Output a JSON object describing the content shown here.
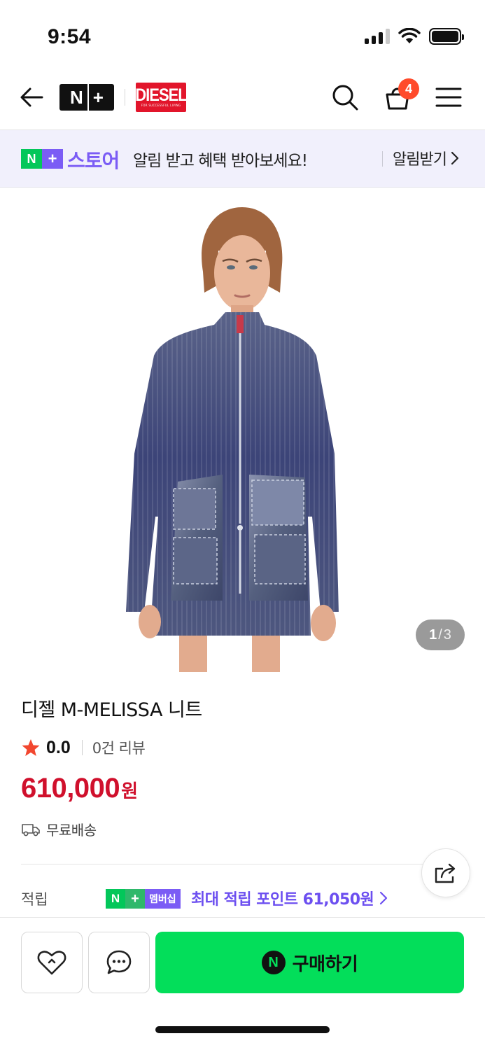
{
  "status_bar": {
    "time": "9:54",
    "icons": [
      "signal-icon",
      "wifi-icon",
      "battery-icon"
    ]
  },
  "nav": {
    "back_icon": "arrow-left-icon",
    "nplus_logo": "N+",
    "brand_logo": "DIESEL",
    "brand_tagline": "FOR SUCCESSFUL LIVING",
    "search_icon": "search-icon",
    "cart_icon": "shopping-bag-icon",
    "cart_count": "4",
    "menu_icon": "hamburger-menu-icon"
  },
  "store_banner": {
    "logo_n": "N",
    "logo_plus": "+",
    "store_label": "스토어",
    "message": "알림 받고 혜택 받아보세요!",
    "cta_label": "알림받기"
  },
  "product": {
    "image_counter_current": "1",
    "image_counter_separator": "/",
    "image_counter_total": "3",
    "title": "디젤 M-MELISSA 니트",
    "rating": "0.0",
    "review_count": "0건 리뷰",
    "price": "610,000",
    "price_unit": "원",
    "shipping": "무료배송"
  },
  "points": {
    "label": "적립",
    "badge_n": "N",
    "badge_plus": "+",
    "badge_member": "멤버십",
    "text": "최대 적립 포인트 61,050원"
  },
  "bottom_bar": {
    "buy_icon_letter": "N",
    "buy_label": "구매하기"
  },
  "colors": {
    "naver_green": "#03c75a",
    "buy_green": "#03de5a",
    "plus_purple": "#7b5cf5",
    "price_red": "#d0102c",
    "badge_orange": "#ff4b2b",
    "diesel_red": "#e2152b"
  }
}
